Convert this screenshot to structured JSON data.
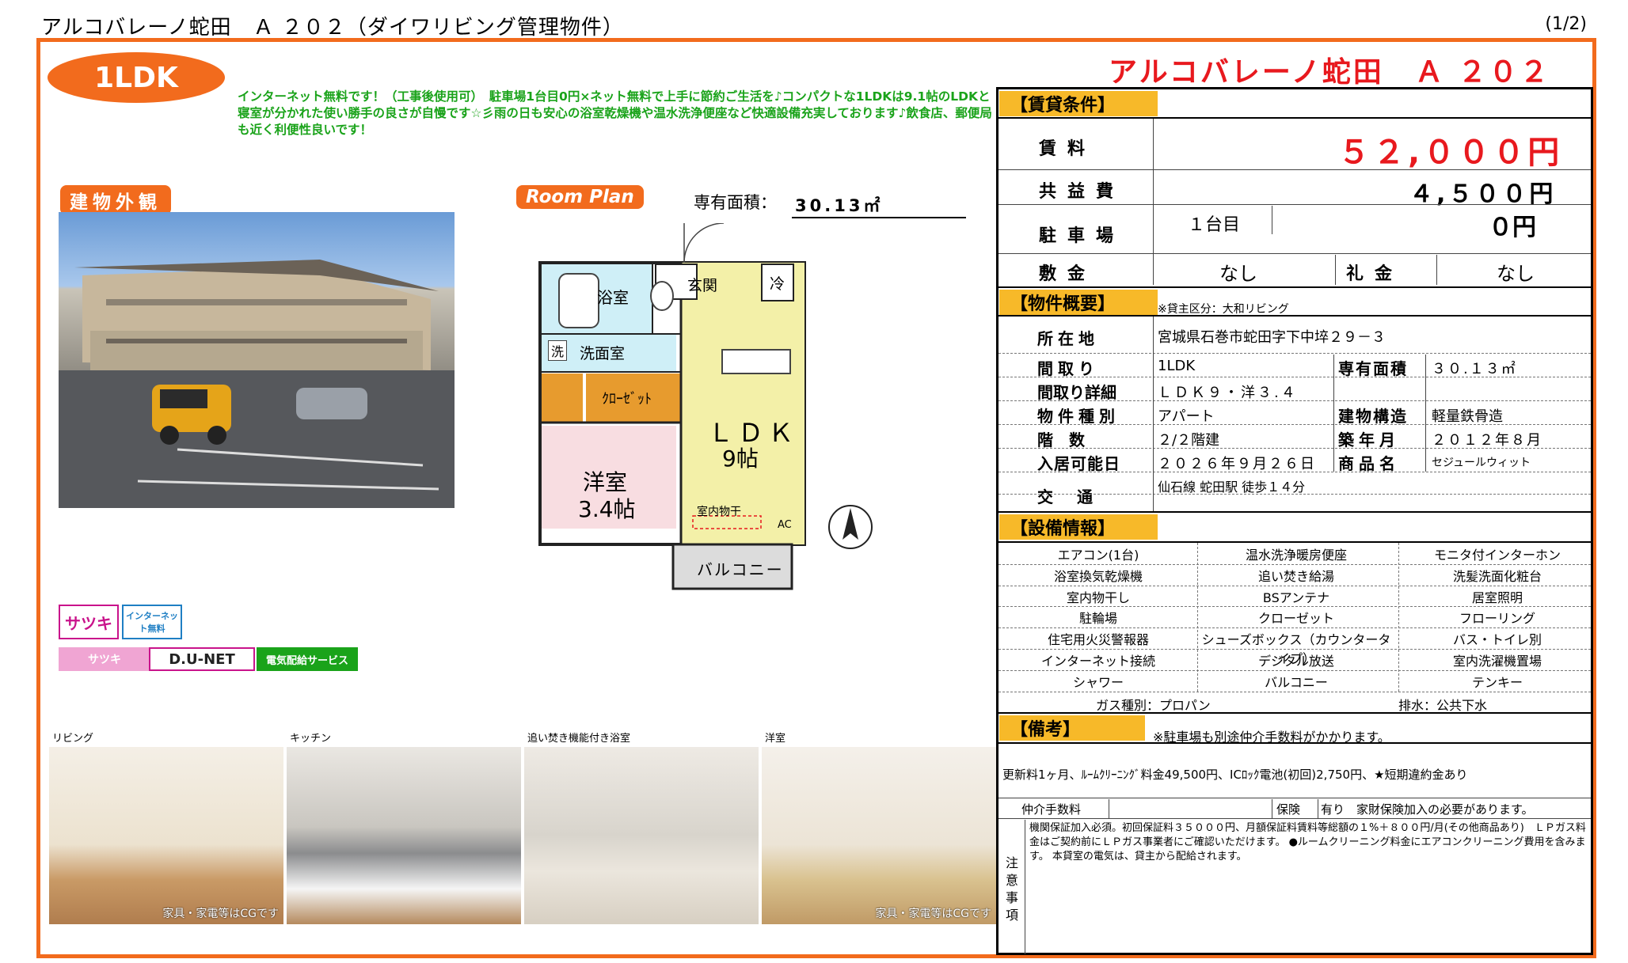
{
  "header": {
    "title": "アルコバレーノ蛇田　Ａ ２０２（ダイワリビング管理物件）",
    "page": "(1/2)"
  },
  "badge": "1LDK",
  "intro": "インターネット無料です！（工事後使用可）　駐車場1台目0円×ネット無料で上手に節約ご生活を♪コンパクトな1LDKは9.1帖のLDKと寝室が分かれた使い勝手の良さが自慢です☆彡雨の日も安心の浴室乾燥機や温水洗浄便座など快適設備充実しております♪飲食店、郵便局も近く利便性良いです！",
  "exterior_label": "建物外観",
  "room_plan_label": "Room Plan",
  "area_label": "専有面積：",
  "area_value": "30.13㎡",
  "floorplan": {
    "bath": "浴室",
    "wash_icon": "洗",
    "washroom": "洗面室",
    "entrance": "玄関",
    "fridge": "冷",
    "closet": "ｸﾛｰｾﾞｯﾄ",
    "ldk": "ＬＤＫ",
    "ldk_size": "9帖",
    "western": "洋室",
    "western_size": "3.4帖",
    "drying": "室内物干",
    "ac": "AC",
    "balcony": "バルコニー"
  },
  "logos": {
    "satsuki": "サツキ",
    "internet_free": "インターネット無料",
    "satsuki2": "サツキ",
    "dunet": "D.U-NET",
    "electric": "電気配給サービス"
  },
  "photos": [
    {
      "caption": "リビング",
      "note": "家具・家電等はCGです"
    },
    {
      "caption": "キッチン",
      "note": ""
    },
    {
      "caption": "追い焚き機能付き浴室",
      "note": ""
    },
    {
      "caption": "洋室",
      "note": "家具・家電等はCGです"
    }
  ],
  "property_name": "アルコバレーノ蛇田　Ａ ２０２",
  "sections": {
    "rent_terms": "【賃貸条件】",
    "overview": "【物件概要】",
    "equipment": "【設備情報】",
    "remarks": "【備考】"
  },
  "rent": {
    "rent_label": "賃料",
    "rent_value": "５２,０００円",
    "common_label": "共益費",
    "common_value": "４,５００円",
    "parking_label": "駐車場",
    "parking_note": "１台目",
    "parking_value": "０円",
    "deposit_label": "敷金",
    "deposit_value": "なし",
    "key_label": "礼金",
    "key_value": "なし"
  },
  "overview": {
    "landlord_note": "※貸主区分：大和リビング",
    "address_label": "所在地",
    "address": "宮城県石巻市蛇田字下中埣２９－３",
    "layout_label": "間取り",
    "layout": "1LDK",
    "area_label": "専有面積",
    "area": "３０.１３㎡",
    "layout_detail_label": "間取り詳細",
    "layout_detail": "ＬＤＫ９・洋３.４",
    "type_label": "物件種別",
    "type": "アパート",
    "structure_label": "建物構造",
    "structure": "軽量鉄骨造",
    "floor_label": "階数",
    "floor": "２/２階建",
    "built_label": "築年月",
    "built": "２０１２年８月",
    "move_in_label": "入居可能日",
    "move_in": "２０２６年９月２６日",
    "product_label": "商品名",
    "product": "セジュールウィット",
    "access_label": "交通",
    "access": "仙石線 蛇田駅 徒歩１４分"
  },
  "equipment": [
    [
      "エアコン(1台)",
      "温水洗浄暖房便座",
      "モニタ付インターホン"
    ],
    [
      "浴室換気乾燥機",
      "追い焚き給湯",
      "洗髪洗面化粧台"
    ],
    [
      "室内物干し",
      "BSアンテナ",
      "居室照明"
    ],
    [
      "駐輪場",
      "クローゼット",
      "フローリング"
    ],
    [
      "住宅用火災警報器",
      "シューズボックス（カウンタータイプ）",
      "バス・トイレ別"
    ],
    [
      "インターネット接続",
      "デジタル放送",
      "室内洗濯機置場"
    ],
    [
      "シャワー",
      "バルコニー",
      "テンキー"
    ]
  ],
  "gas": "ガス種別：プロパン",
  "drain": "排水：公共下水",
  "remarks": {
    "note": "※駐車場も別途仲介手数料がかかります。",
    "renewal": "更新料1ヶ月、ﾙｰﾑｸﾘｰﾆﾝｸﾞ料金49,500円、ICﾛｯｸ電池(初回)2,750円、★短期違約金あり",
    "fee_label": "仲介手数料",
    "insurance_label": "保険",
    "insurance": "有り　家財保険加入の必要があります。",
    "caution_label": "注意事項",
    "caution": "機関保証加入必須。初回保証料３５０００円、月額保証料賃料等総額の１%＋８００円/月(その他商品あり)　ＬＰガス料金はご契約前にＬＰガス事業者にご確認いただけます。 ●ルームクリーニング料金にエアコンクリーニング費用を含みます。 本貸室の電気は、貸主から配給されます。"
  }
}
